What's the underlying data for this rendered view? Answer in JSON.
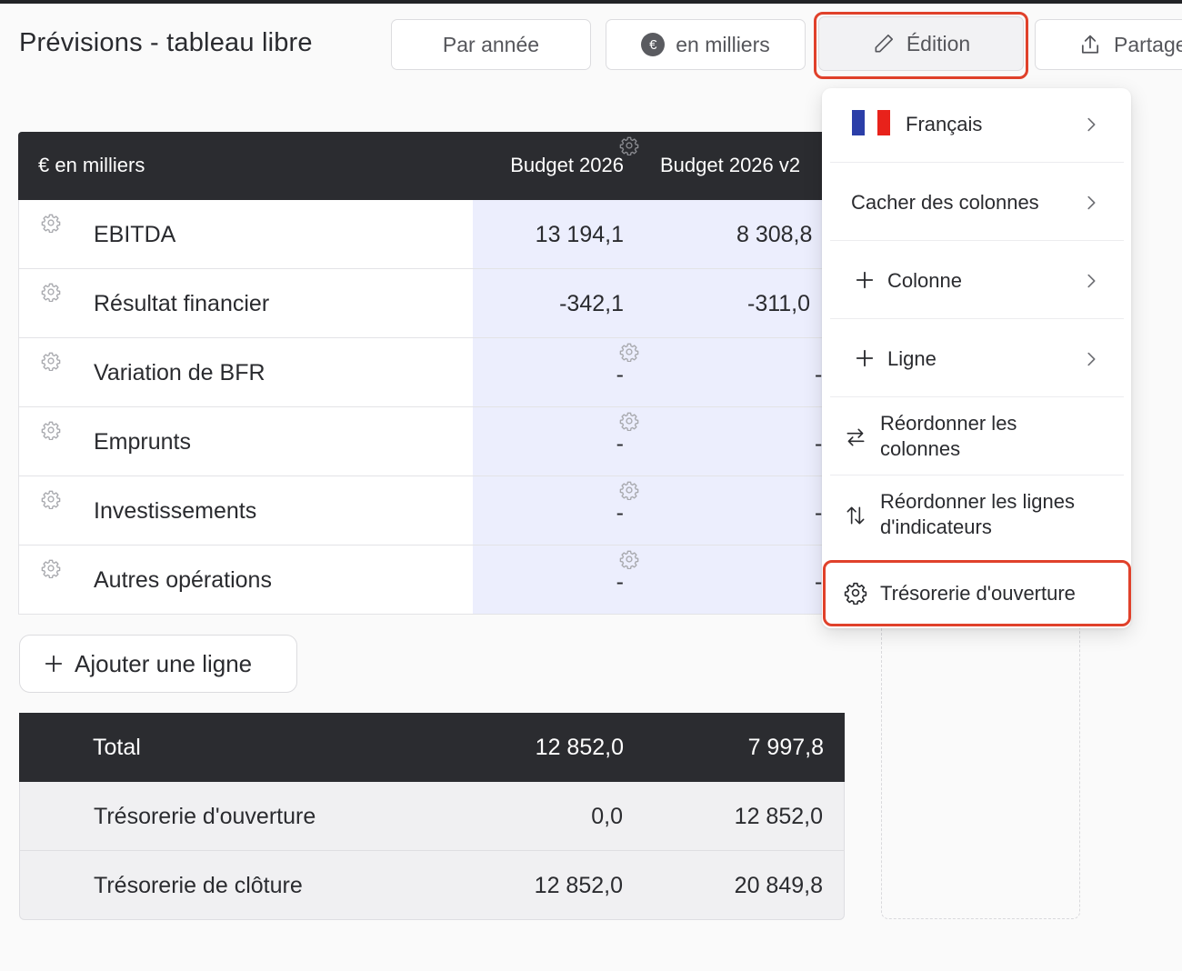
{
  "page": {
    "title": "Prévisions - tableau libre"
  },
  "toolbar": {
    "period_label": "Par année",
    "unit_label": "en milliers",
    "unit_symbol": "€",
    "edit_label": "Édition",
    "share_label": "Partage"
  },
  "table": {
    "header": {
      "unit": "€ en milliers",
      "col1": "Budget 2026",
      "col2": "Budget 2026 v2"
    },
    "rows": [
      {
        "label": "EBITDA",
        "v1": "13 194,1",
        "v2": "8 308,8"
      },
      {
        "label": "Résultat financier",
        "v1": "-342,1",
        "v2": "-311,0"
      },
      {
        "label": "Variation de BFR",
        "v1": "-",
        "v2": "-"
      },
      {
        "label": "Emprunts",
        "v1": "-",
        "v2": "-"
      },
      {
        "label": "Investissements",
        "v1": "-",
        "v2": "-"
      },
      {
        "label": "Autres opérations",
        "v1": "-",
        "v2": "-"
      }
    ],
    "add_row_label": "Ajouter une ligne",
    "totals": [
      {
        "label": "Total",
        "v1": "12 852,0",
        "v2": "7 997,8"
      },
      {
        "label": "Trésorerie d'ouverture",
        "v1": "0,0",
        "v2": "12 852,0"
      },
      {
        "label": "Trésorerie de clôture",
        "v1": "12 852,0",
        "v2": "20 849,8"
      }
    ]
  },
  "menu": {
    "items": [
      {
        "label": "Français",
        "icon": "france-flag-icon"
      },
      {
        "label": "Cacher des colonnes"
      },
      {
        "label": "Colonne",
        "icon": "plus-icon"
      },
      {
        "label": "Ligne",
        "icon": "plus-icon"
      },
      {
        "label": "Réordonner les colonnes",
        "line1": "Réordonner les",
        "line2": "colonnes",
        "icon": "swap-horizontal-icon"
      },
      {
        "label": "Réordonner les lignes d'indicateurs",
        "line1": "Réordonner les lignes",
        "line2": "d'indicateurs",
        "icon": "swap-vertical-icon"
      },
      {
        "label": "Trésorerie d'ouverture",
        "icon": "gear-icon"
      }
    ]
  },
  "colors": {
    "highlight": "#e0412b",
    "header_bg": "#2b2c30",
    "column_band": "#eceefd"
  }
}
